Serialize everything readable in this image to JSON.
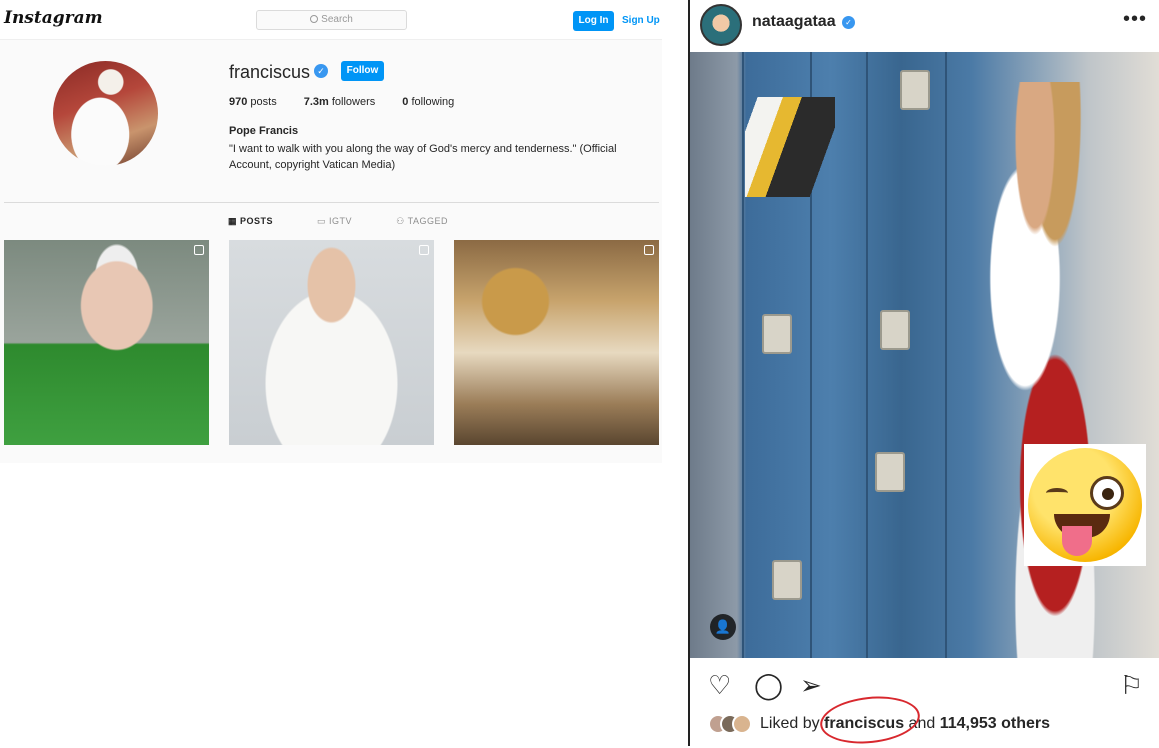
{
  "profile_page": {
    "logo": "Instagram",
    "search_placeholder": "Search",
    "login_label": "Log In",
    "signup_label": "Sign Up",
    "username": "franciscus",
    "follow_label": "Follow",
    "stats": {
      "posts_value": "970",
      "posts_label": "posts",
      "followers_value": "7.3m",
      "followers_label": "followers",
      "following_value": "0",
      "following_label": "following"
    },
    "full_name": "Pope Francis",
    "bio": "\"I want to walk with you along the way of God's mercy and tenderness.\" (Official Account, copyright Vatican Media)",
    "tabs": [
      {
        "label": "POSTS",
        "icon": "grid-icon",
        "active": true
      },
      {
        "label": "IGTV",
        "icon": "tv-icon",
        "active": false
      },
      {
        "label": "TAGGED",
        "icon": "tag-person-icon",
        "active": false
      }
    ],
    "posts": [
      {
        "badge_icon": "camera-icon"
      },
      {
        "badge_icon": "video-icon"
      },
      {
        "badge_icon": "carousel-icon"
      }
    ]
  },
  "post": {
    "username": "nataagataa",
    "more_icon": "more-icon",
    "liked_by_prefix": "Liked by",
    "liked_by_user": "franciscus",
    "and_text": "and",
    "likes_count": "114,953 others",
    "colors": {
      "accent_blue": "#0095f6",
      "verified_blue": "#3897f0",
      "circle_red": "#d8282e"
    }
  }
}
